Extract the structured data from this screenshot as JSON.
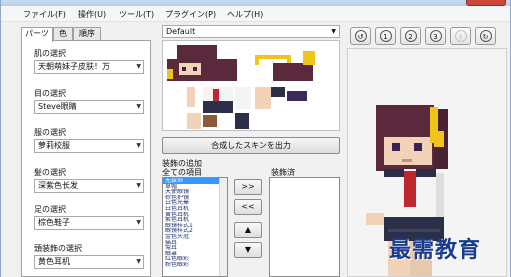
{
  "menu": [
    "ファイル(F)",
    "操作(U)",
    "ツール(T)",
    "プラグイン(P)",
    "ヘルプ(H)"
  ],
  "tabs": [
    {
      "label": "パーツ",
      "active": true
    },
    {
      "label": "色",
      "active": false
    },
    {
      "label": "順序",
      "active": false
    }
  ],
  "fields": [
    {
      "label": "肌の選択",
      "value": "天朝萌妹子皮肤！万"
    },
    {
      "label": "目の選択",
      "value": "Steve眼睛"
    },
    {
      "label": "服の選択",
      "value": "萝莉校服"
    },
    {
      "label": "髪の選択",
      "value": "深紫色长发"
    },
    {
      "label": "足の選択",
      "value": "棕色鞋子"
    },
    {
      "label": "頭装飾の選択",
      "value": "黄色耳机"
    }
  ],
  "skin_select": {
    "value": "Default"
  },
  "merge_button": "合成したスキンを出力",
  "decoration": {
    "title": "装飾の追加",
    "all_items_label": "全ての項目",
    "equipped_label": "装飾済",
    "items": [
      "无装饰",
      "草帽",
      "天使眼镜",
      "棕色护镜",
      "白色光晕",
      "白色耳机",
      "黄色耳机",
      "紫色耳机",
      "眼镜样式1",
      "眼镜样式2",
      "金色头冠",
      "猫耳",
      "兔耳",
      "眼罩",
      "红色眼彩",
      "粉色眼彩"
    ],
    "selected_index": 0
  },
  "move_buttons": [
    ">>",
    "<<",
    "▲",
    "▼"
  ],
  "toolbar": [
    {
      "name": "reset-icon",
      "glyph": "↺",
      "enabled": true
    },
    {
      "name": "view-1-icon",
      "glyph": "1",
      "enabled": true
    },
    {
      "name": "view-2-icon",
      "glyph": "2",
      "enabled": true
    },
    {
      "name": "view-3-icon",
      "glyph": "3",
      "enabled": true
    },
    {
      "name": "pause-icon",
      "glyph": "Ⅱ",
      "enabled": false
    },
    {
      "name": "loop-icon",
      "glyph": "↻",
      "enabled": true
    }
  ],
  "watermark": "最需教育",
  "colors": {
    "hair": "#5a2a3c",
    "skin": "#f2d3b8",
    "shirt": "#f4f4f4",
    "tie": "#c0262d",
    "skirt": "#2b2f48",
    "headphone": "#f0c419",
    "shoes": "#8a5a3a"
  }
}
